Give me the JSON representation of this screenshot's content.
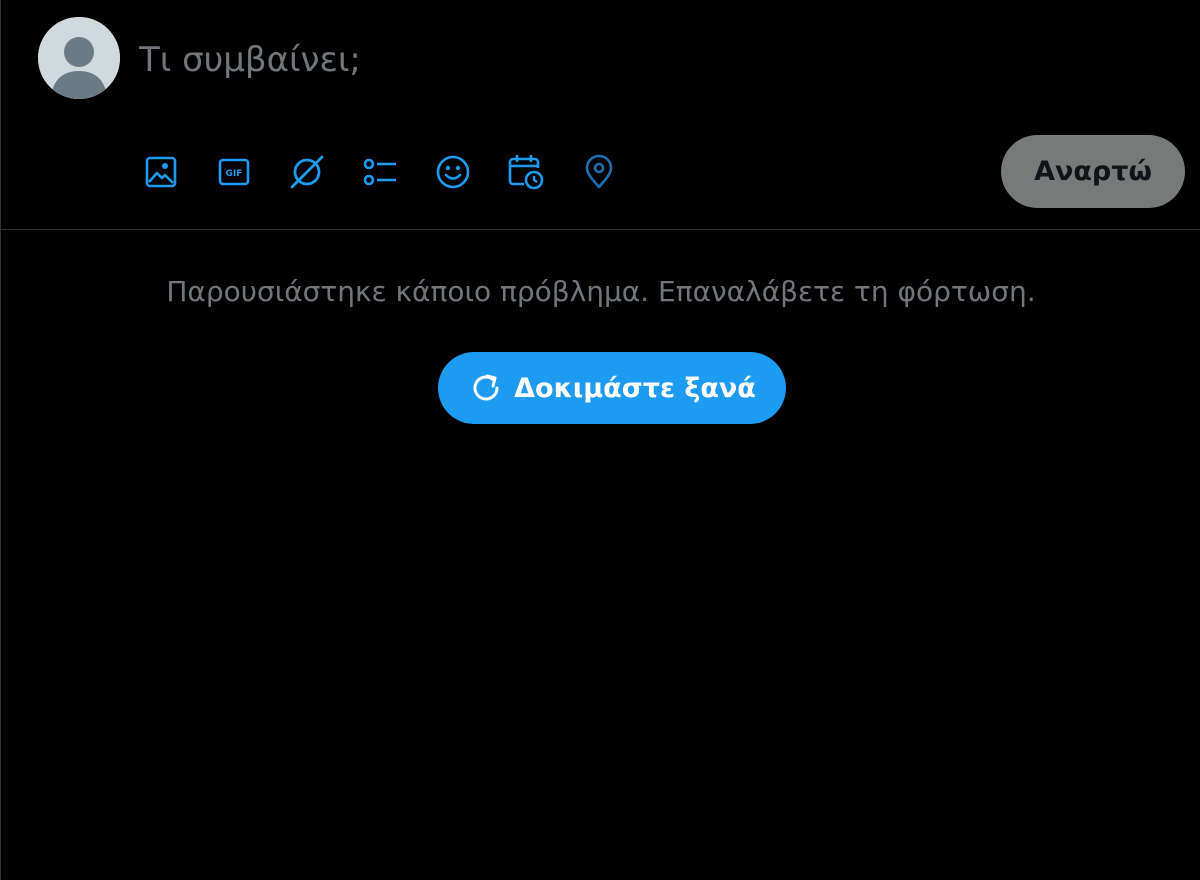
{
  "composer": {
    "avatar_icon": "default-profile-icon",
    "placeholder": "Τι συμβαίνει;",
    "post_label": "Αναρτώ",
    "tools": [
      {
        "icon": "image-icon"
      },
      {
        "icon": "gif-icon",
        "text": "GIF"
      },
      {
        "icon": "grok-icon"
      },
      {
        "icon": "poll-icon"
      },
      {
        "icon": "emoji-icon"
      },
      {
        "icon": "schedule-icon"
      },
      {
        "icon": "location-icon"
      }
    ]
  },
  "error": {
    "message": "Παρουσιάστηκε κάποιο πρόβλημα. Επαναλάβετε τη φόρτωση.",
    "retry_label": "Δοκιμάστε ξανά",
    "retry_icon": "refresh-icon"
  },
  "colors": {
    "background": "#000000",
    "accent": "#1d9bf0",
    "muted_text": "#71767b",
    "divider": "#2f3336",
    "post_button_disabled": "#787a7a"
  }
}
